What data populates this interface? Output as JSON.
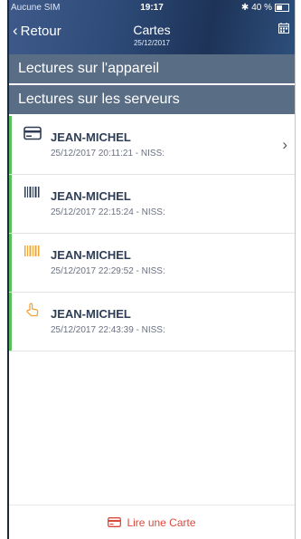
{
  "status_bar": {
    "carrier": "Aucune SIM",
    "time": "19:17",
    "battery": "40 %"
  },
  "header": {
    "back_label": "Retour",
    "title": "Cartes",
    "subtitle": "25/12/2017"
  },
  "tabs": [
    {
      "label": "Lectures sur l'appareil"
    },
    {
      "label": "Lectures sur les serveurs"
    }
  ],
  "readings": [
    {
      "name": "JEAN-MICHEL",
      "detail": "25/12/2017 20:11:21 - NISS:",
      "icon": "card-icon",
      "icon_color": "#2e3d55"
    },
    {
      "name": "JEAN-MICHEL",
      "detail": "25/12/2017 22:15:24 - NISS:",
      "icon": "barcode-icon",
      "icon_color": "#2e3d55"
    },
    {
      "name": "JEAN-MICHEL",
      "detail": "25/12/2017 22:29:52 - NISS:",
      "icon": "barcode-icon",
      "icon_color": "#f0a53a"
    },
    {
      "name": "JEAN-MICHEL",
      "detail": "25/12/2017 22:43:39 - NISS:",
      "icon": "hand-pointer-icon",
      "icon_color": "#f0a53a"
    }
  ],
  "footer": {
    "label": "Lire une Carte",
    "color": "#d9483b"
  },
  "colors": {
    "accent_bar": "#5bbf5b",
    "tab_bg": "#596d85"
  }
}
